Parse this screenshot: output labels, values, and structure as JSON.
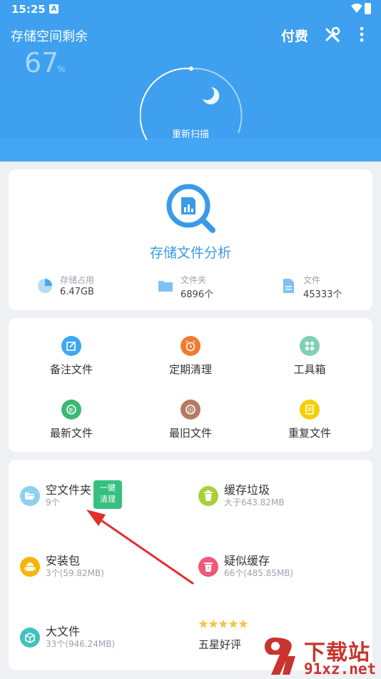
{
  "status_bar": {
    "time": "15:25",
    "notification_glyph": "A"
  },
  "header": {
    "title": "存储空间剩余",
    "pay_label": "付费",
    "percent_value": "67",
    "percent_unit": "%",
    "rescan_label": "重新扫描",
    "icons": [
      "tools-icon",
      "more-vertical-icon"
    ]
  },
  "analysis": {
    "title": "存储文件分析",
    "stats": [
      {
        "label": "存储占用",
        "value": "6.47GB",
        "icon": "pie-chart-icon"
      },
      {
        "label": "文件夹",
        "value": "6896个",
        "icon": "folder-icon"
      },
      {
        "label": "文件",
        "value": "45333个",
        "icon": "file-icon"
      }
    ]
  },
  "tools": [
    {
      "label": "备注文件",
      "icon": "note-icon",
      "color": "#3ea8f0"
    },
    {
      "label": "定期清理",
      "icon": "alarm-icon",
      "color": "#f07a30"
    },
    {
      "label": "工具箱",
      "icon": "toolbox-icon",
      "color": "#7fd0b4"
    },
    {
      "label": "最新文件",
      "icon": "new-file-icon",
      "color": "#3cb871"
    },
    {
      "label": "最旧文件",
      "icon": "old-file-icon",
      "color": "#b57a62"
    },
    {
      "label": "重复文件",
      "icon": "duplicate-icon",
      "color": "#f3d000"
    }
  ],
  "clean": {
    "items": [
      {
        "title": "空文件夹",
        "sub": "9个",
        "icon": "folder-open-icon",
        "color": "#8ed0f0"
      },
      {
        "title": "缓存垃圾",
        "sub": "大于643.82MB",
        "icon": "trash-icon",
        "color": "#a9cf3a"
      },
      {
        "title": "安装包",
        "sub": "3个(59.82MB)",
        "icon": "android-icon",
        "color": "#f7b500"
      },
      {
        "title": "疑似缓存",
        "sub": "66个(485.85MB)",
        "icon": "suspect-cache-icon",
        "color": "#ee5a78"
      },
      {
        "title": "大文件",
        "sub": "33个(946.24MB)",
        "icon": "box-icon",
        "color": "#40c2c0"
      }
    ],
    "one_key_line1": "一键",
    "one_key_line2": "清理",
    "rating_label": "五星好评",
    "rating_stars": 5
  },
  "watermark": {
    "text1": "下载站",
    "text2": "91xz.net"
  },
  "colors": {
    "header": "#3ea0ef",
    "accent": "#3a9ae8",
    "arrow": "#e0302a"
  }
}
